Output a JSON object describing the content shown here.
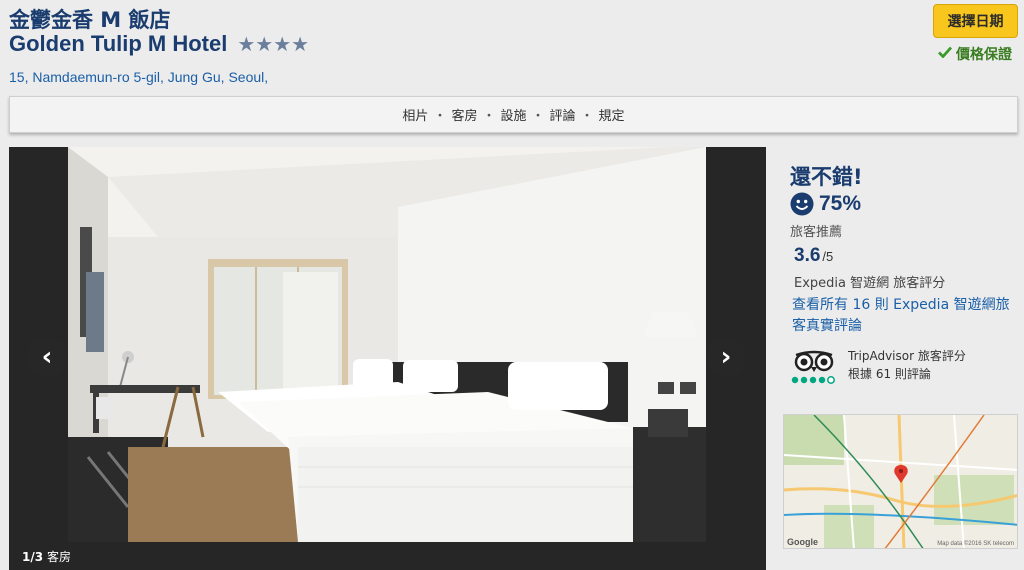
{
  "hotel": {
    "name_zh": "金鬱金香 M 飯店",
    "name_en": "Golden Tulip M Hotel",
    "star_rating": 4,
    "address": "15, Namdaemun-ro 5-gil, Jung Gu,  Seoul,"
  },
  "actions": {
    "select_dates_label": "選擇日期",
    "price_guarantee_label": "價格保證"
  },
  "nav": {
    "items": [
      "相片",
      "客房",
      "設施",
      "評論",
      "規定"
    ],
    "separator": "・"
  },
  "gallery": {
    "current": "1",
    "total": "3",
    "caption": "客房",
    "prev_icon": "chevron-left-icon",
    "next_icon": "chevron-right-icon"
  },
  "rating": {
    "headline": "還不錯!",
    "recommend_pct": "75%",
    "recommend_label": "旅客推薦",
    "score": "3.6",
    "score_max": "/5",
    "score_label": "Expedia 智遊網 旅客評分",
    "reviews_link": "查看所有 16 則 Expedia 智遊網旅客真實評論"
  },
  "tripadvisor": {
    "label": "TripAdvisor 旅客評分",
    "reviews": "根據 61 則評論",
    "bubbles": 5,
    "logo_icon": "tripadvisor-owl-icon"
  },
  "map": {
    "provider": "Google",
    "credit": "Map data ©2016 SK telecom"
  },
  "colors": {
    "brand_navy": "#1a3c6e",
    "link_blue": "#1a5fa8",
    "cta_yellow": "#f8c61c",
    "guarantee_green": "#3a7d22",
    "tripadvisor_green": "#00a680"
  }
}
